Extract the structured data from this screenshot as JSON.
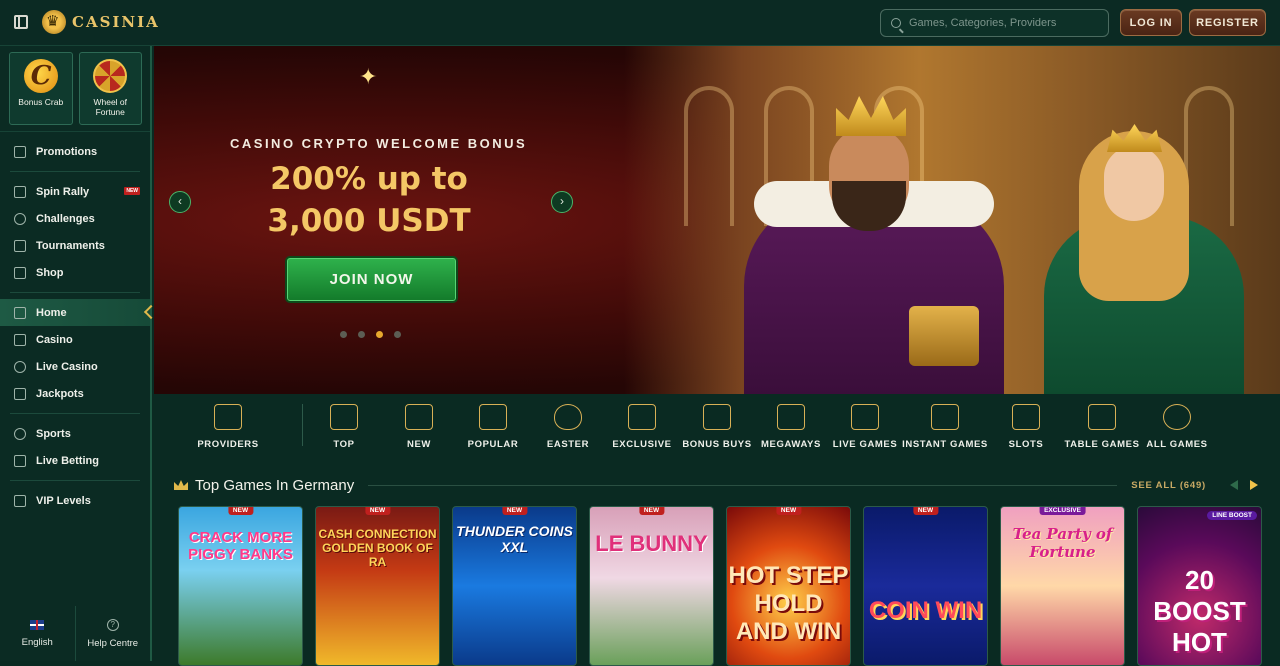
{
  "header": {
    "brand": "CASINIA",
    "search_placeholder": "Games, Categories, Providers",
    "login_label": "LOG IN",
    "register_label": "REGISTER"
  },
  "sidebar": {
    "tiles": [
      {
        "label": "Bonus Crab",
        "icon": "crab-icon"
      },
      {
        "label": "Wheel of Fortune",
        "icon": "wheel-icon"
      }
    ],
    "promotions": "Promotions",
    "group1": [
      {
        "label": "Spin Rally",
        "icon": "flag-icon",
        "badge": "NEW"
      },
      {
        "label": "Challenges",
        "icon": "trophy-icon"
      },
      {
        "label": "Tournaments",
        "icon": "cup-icon"
      },
      {
        "label": "Shop",
        "icon": "shop-icon"
      }
    ],
    "group2": [
      {
        "label": "Home",
        "icon": "home-icon",
        "active": true
      },
      {
        "label": "Casino",
        "icon": "cards-icon"
      },
      {
        "label": "Live Casino",
        "icon": "chip-icon"
      },
      {
        "label": "Jackpots",
        "icon": "jackpot-icon"
      }
    ],
    "group3": [
      {
        "label": "Sports",
        "icon": "ball-icon"
      },
      {
        "label": "Live Betting",
        "icon": "betting-icon"
      }
    ],
    "vip": "VIP Levels",
    "footer": {
      "language": "English",
      "help": "Help Centre"
    }
  },
  "hero": {
    "kicker": "CASINO CRYPTO WELCOME BONUS",
    "title": "200% up to 3,000 USDT",
    "cta": "JOIN NOW",
    "slides": 4,
    "active_slide": 3
  },
  "categories": [
    {
      "label": "PROVIDERS",
      "icon": "providers-icon"
    },
    {
      "label": "TOP",
      "icon": "crown-icon"
    },
    {
      "label": "NEW",
      "icon": "new-icon"
    },
    {
      "label": "POPULAR",
      "icon": "popular-icon"
    },
    {
      "label": "EASTER",
      "icon": "egg-icon"
    },
    {
      "label": "EXCLUSIVE",
      "icon": "diamond-icon"
    },
    {
      "label": "BONUS BUYS",
      "icon": "bonus-buys-icon"
    },
    {
      "label": "MEGAWAYS",
      "icon": "megaways-icon"
    },
    {
      "label": "LIVE GAMES",
      "icon": "live-games-icon"
    },
    {
      "label": "INSTANT GAMES",
      "icon": "instant-games-icon"
    },
    {
      "label": "SLOTS",
      "icon": "slots-icon"
    },
    {
      "label": "TABLE GAMES",
      "icon": "table-games-icon"
    },
    {
      "label": "ALL GAMES",
      "icon": "cherries-icon"
    }
  ],
  "top_games": {
    "title": "Top Games In Germany",
    "see_all": "SEE ALL (649)",
    "games": [
      {
        "title": "CRACK MORE PIGGY BANKS",
        "badge": "NEW"
      },
      {
        "title": "CASH CONNECTION GOLDEN BOOK OF RA",
        "badge": "NEW"
      },
      {
        "title": "THUNDER COINS XXL",
        "badge": "NEW"
      },
      {
        "title": "LE BUNNY",
        "badge": "NEW"
      },
      {
        "title": "HOT STEP HOLD AND WIN",
        "badge": "NEW"
      },
      {
        "title": "COIN WIN",
        "badge": "NEW"
      },
      {
        "title": "Tea Party of Fortune",
        "badge": "EXCLUSIVE"
      },
      {
        "title": "20 BOOST HOT",
        "badge": "LINE BOOST"
      }
    ]
  }
}
